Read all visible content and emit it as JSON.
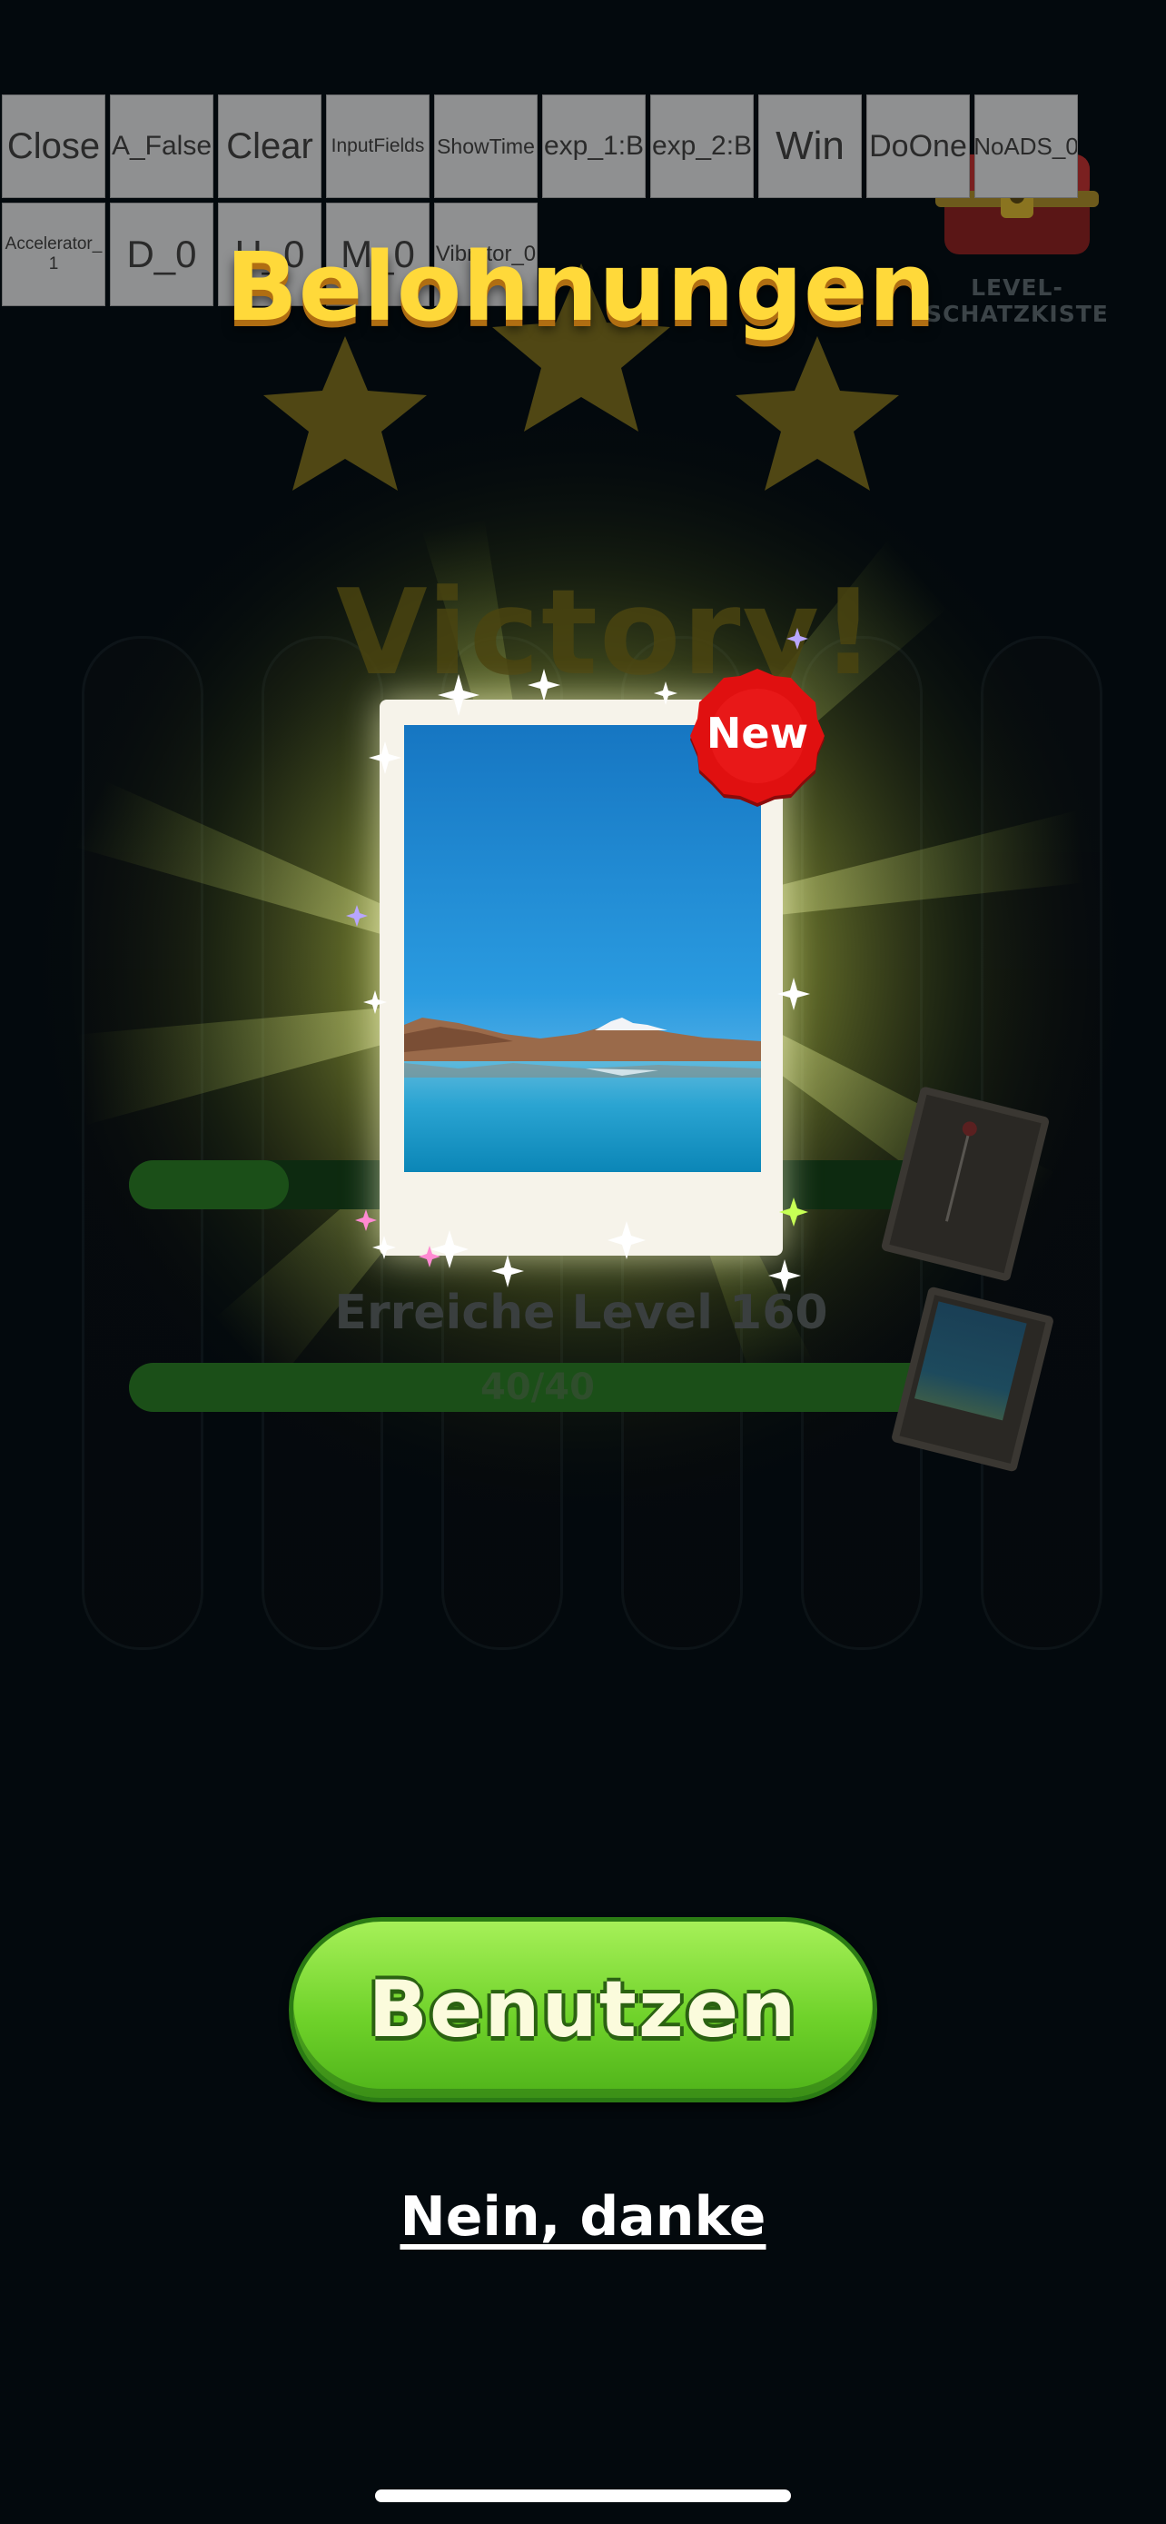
{
  "debug_buttons": {
    "row1": [
      "Close",
      "A_False",
      "Clear",
      "InputFields",
      "ShowTime",
      "exp_1:B",
      "exp_2:B",
      "Win",
      "DoOne",
      "NoADS_0"
    ],
    "row2": [
      "Accelerator_1",
      "D_0",
      "H_0",
      "M_0",
      "Vibrator_0"
    ]
  },
  "chest": {
    "label": "LEVEL-SCHATZKISTE"
  },
  "title": "Belohnungen",
  "background": {
    "victory": "Victory!",
    "level_goal": "Erreiche Level 160",
    "progress_text": "40/40",
    "progress_fraction": 1.0
  },
  "reward": {
    "badge": "New"
  },
  "buttons": {
    "use": "Benutzen",
    "no_thanks": "Nein, danke"
  },
  "colors": {
    "title": "#ffd93a",
    "use_button": "#6fd22a",
    "badge": "#e01010"
  }
}
